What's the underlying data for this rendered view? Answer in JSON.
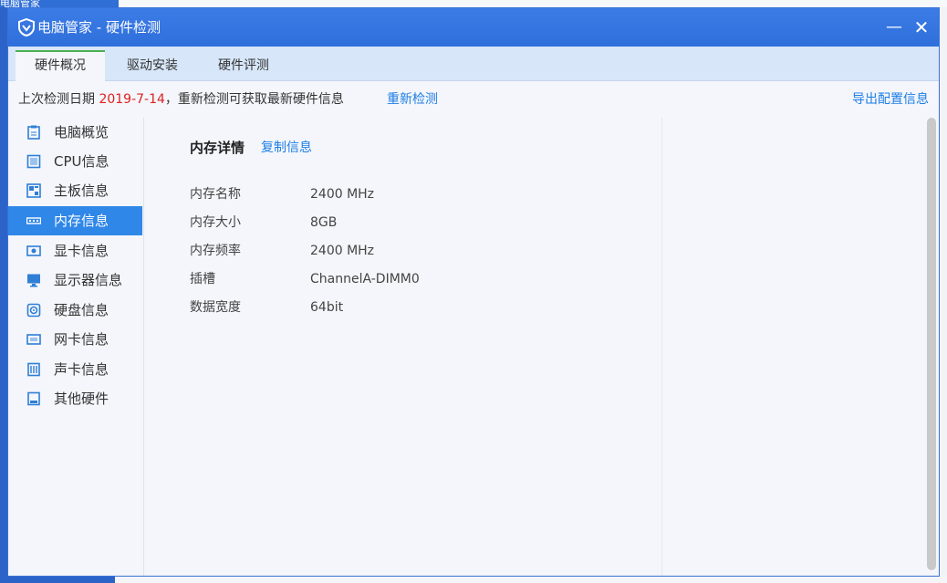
{
  "background": {
    "app_title": "电脑管家"
  },
  "window": {
    "title": "电脑管家 - 硬件检测",
    "minimize": "—",
    "close": "✕"
  },
  "tabs": [
    {
      "label": "硬件概况",
      "active": true
    },
    {
      "label": "驱动安装",
      "active": false
    },
    {
      "label": "硬件评测",
      "active": false
    }
  ],
  "infobar": {
    "prefix": "上次检测日期 ",
    "date": "2019-7-14",
    "suffix": "，重新检测可获取最新硬件信息",
    "recheck": "重新检测",
    "export": "导出配置信息"
  },
  "sidebar": {
    "items": [
      {
        "label": "电脑概览",
        "icon": "clipboard-icon"
      },
      {
        "label": "CPU信息",
        "icon": "cpu-icon"
      },
      {
        "label": "主板信息",
        "icon": "motherboard-icon"
      },
      {
        "label": "内存信息",
        "icon": "memory-icon",
        "active": true
      },
      {
        "label": "显卡信息",
        "icon": "graphics-card-icon"
      },
      {
        "label": "显示器信息",
        "icon": "monitor-icon"
      },
      {
        "label": "硬盘信息",
        "icon": "disk-icon"
      },
      {
        "label": "网卡信息",
        "icon": "network-card-icon"
      },
      {
        "label": "声卡信息",
        "icon": "sound-card-icon"
      },
      {
        "label": "其他硬件",
        "icon": "other-hardware-icon"
      }
    ]
  },
  "detail": {
    "title": "内存详情",
    "copy": "复制信息",
    "rows": [
      {
        "key": "内存名称",
        "value": "2400 MHz"
      },
      {
        "key": "内存大小",
        "value": "8GB"
      },
      {
        "key": "内存频率",
        "value": "2400 MHz"
      },
      {
        "key": "插槽",
        "value": "ChannelA-DIMM0"
      },
      {
        "key": "数据宽度",
        "value": "64bit"
      }
    ]
  },
  "colors": {
    "accent": "#2f87e8",
    "date_red": "#e02020",
    "link": "#1e7fe6",
    "titlebar": "#3575e0"
  }
}
